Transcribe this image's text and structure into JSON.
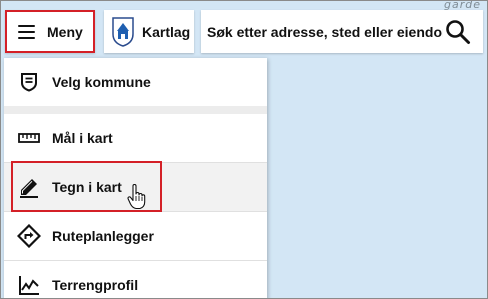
{
  "colors": {
    "highlight": "#d42027",
    "map_background": "#d3e6f5",
    "menu_hover": "#f2f2f2"
  },
  "map": {
    "corner_label": "garde"
  },
  "toolbar": {
    "menu_label": "Meny",
    "layers_label": "Kartlag",
    "search_placeholder": "Søk etter adresse, sted eller eiendom"
  },
  "menu": {
    "items": [
      {
        "label": "Velg kommune",
        "icon": "municipality-shield-icon"
      },
      {
        "label": "Mål i kart",
        "icon": "ruler-icon"
      },
      {
        "label": "Tegn i kart",
        "icon": "draw-pencil-icon"
      },
      {
        "label": "Ruteplanlegger",
        "icon": "route-icon"
      },
      {
        "label": "Terrengprofil",
        "icon": "terrain-profile-icon"
      }
    ]
  }
}
